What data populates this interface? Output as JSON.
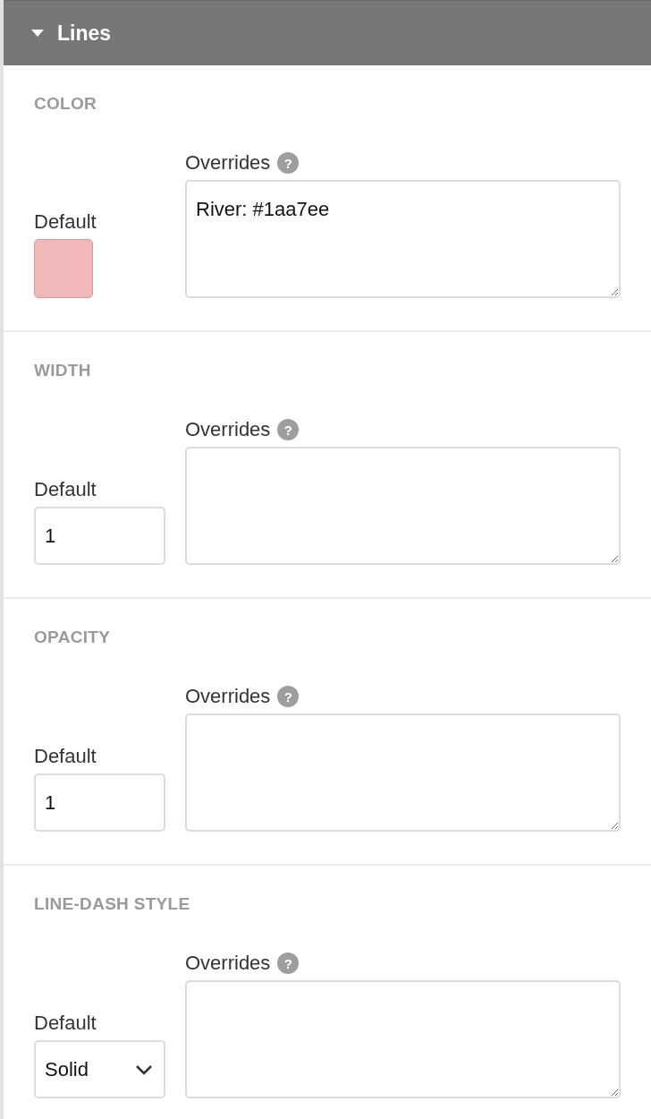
{
  "panel": {
    "title": "Lines",
    "expanded": true
  },
  "sections": [
    {
      "title": "COLOR",
      "default_label": "Default",
      "default": {
        "kind": "color",
        "color": "#f0b8b8"
      },
      "overrides_label": "Overrides",
      "help": "?",
      "overrides_value": "River: #1aa7ee"
    },
    {
      "title": "WIDTH",
      "default_label": "Default",
      "default": {
        "kind": "number",
        "value": "1"
      },
      "overrides_label": "Overrides",
      "help": "?"
    },
    {
      "title": "OPACITY",
      "default_label": "Default",
      "default": {
        "kind": "number",
        "value": "1"
      },
      "overrides_label": "Overrides",
      "help": "?"
    },
    {
      "title": "LINE-DASH STYLE",
      "default_label": "Default",
      "default": {
        "kind": "select",
        "value": "Solid"
      },
      "overrides_label": "Overrides",
      "help": "?"
    }
  ]
}
